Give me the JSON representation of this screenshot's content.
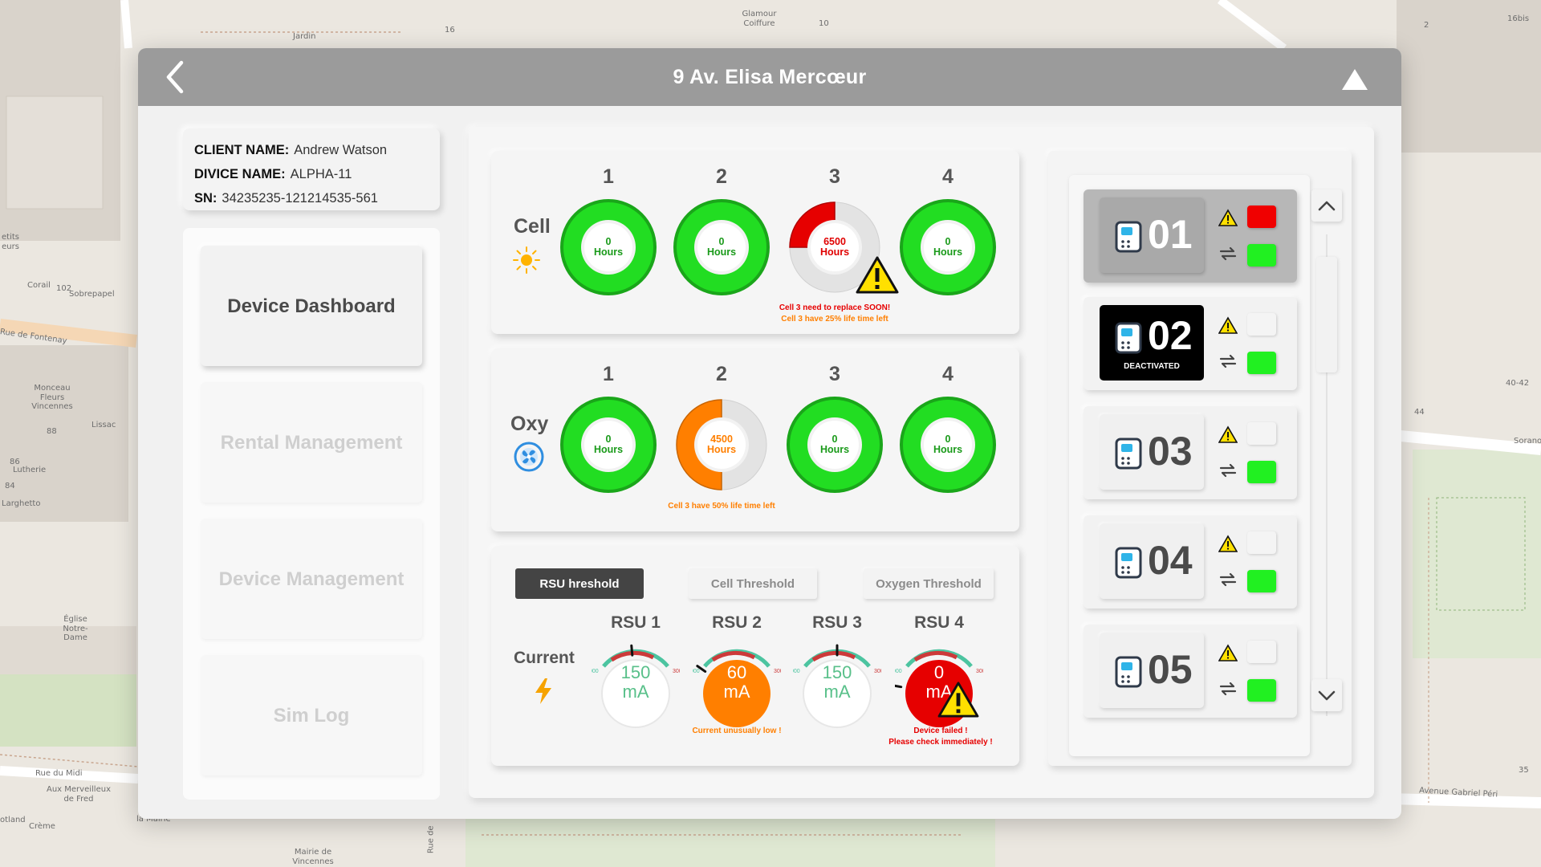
{
  "window": {
    "title": "9 Av. Elisa Mercœur"
  },
  "client": {
    "client_label": "CLIENT NAME:",
    "client_value": "Andrew Watson",
    "device_label": "DIVICE NAME:",
    "device_value": "ALPHA-11",
    "sn_label": "SN:",
    "sn_value": "34235235-121214535-561"
  },
  "nav": [
    {
      "label": "Device Dashboard",
      "active": true
    },
    {
      "label": "Rental Management",
      "active": false
    },
    {
      "label": "Device Management",
      "active": false
    },
    {
      "label": "Sim Log",
      "active": false
    }
  ],
  "cell_section": {
    "label": "Cell",
    "icon": "sun-icon",
    "units": [
      {
        "num": "1",
        "value": "0",
        "unit": "Hours",
        "fill": 1.0,
        "status": "ok"
      },
      {
        "num": "2",
        "value": "0",
        "unit": "Hours",
        "fill": 1.0,
        "status": "ok"
      },
      {
        "num": "3",
        "value": "6500",
        "unit": "Hours",
        "fill": 0.25,
        "status": "critical"
      },
      {
        "num": "4",
        "value": "0",
        "unit": "Hours",
        "fill": 1.0,
        "status": "ok"
      }
    ],
    "warning_line1": "Cell 3 need to replace SOON!",
    "warning_line2": "Cell 3 have 25% life time left"
  },
  "oxy_section": {
    "label": "Oxy",
    "icon": "fan-icon",
    "units": [
      {
        "num": "1",
        "value": "0",
        "unit": "Hours",
        "fill": 1.0,
        "status": "ok"
      },
      {
        "num": "2",
        "value": "4500",
        "unit": "Hours",
        "fill": 0.5,
        "status": "warning"
      },
      {
        "num": "3",
        "value": "0",
        "unit": "Hours",
        "fill": 1.0,
        "status": "ok"
      },
      {
        "num": "4",
        "value": "0",
        "unit": "Hours",
        "fill": 1.0,
        "status": "ok"
      }
    ],
    "warning_line1": "Cell 3 have 50% life time left"
  },
  "threshold_section": {
    "tabs": [
      "RSU hreshold",
      "Cell Threshold",
      "Oxygen Threshold"
    ],
    "active_tab": 0,
    "row_label": "Current",
    "icon": "lightning-icon",
    "scale_min": "000",
    "scale_max": "300",
    "rsus": [
      {
        "name": "RSU 1",
        "value": "150",
        "unit": "mA",
        "status": "ok"
      },
      {
        "name": "RSU 2",
        "value": "60",
        "unit": "mA",
        "status": "warning"
      },
      {
        "name": "RSU 3",
        "value": "150",
        "unit": "mA",
        "status": "ok"
      },
      {
        "name": "RSU 4",
        "value": "0",
        "unit": "mA",
        "status": "critical"
      }
    ],
    "rsu2_message": "Current unusually low !",
    "rsu4_message_line1": "Device failed !",
    "rsu4_message_line2": "Please check immediately !"
  },
  "devices": [
    {
      "num": "01",
      "sub": "",
      "style": "selected",
      "status_top": "red",
      "status_bottom": "green"
    },
    {
      "num": "02",
      "sub": "DEACTIVATED",
      "style": "dark",
      "status_top": "off",
      "status_bottom": "green"
    },
    {
      "num": "03",
      "sub": "",
      "style": "normal",
      "status_top": "off",
      "status_bottom": "green"
    },
    {
      "num": "04",
      "sub": "",
      "style": "normal",
      "status_top": "off",
      "status_bottom": "green"
    },
    {
      "num": "05",
      "sub": "",
      "style": "normal",
      "status_top": "off",
      "status_bottom": "green"
    }
  ],
  "colors": {
    "ok": "#22dd22",
    "ok_dark": "#1aa61a",
    "warning": "#ff7f00",
    "critical": "#e60000",
    "warning_text": "#ff7f00",
    "critical_text": "#e60000"
  },
  "map_labels": {
    "jardin": "Jardin",
    "glamour": "Glamour Coiffure",
    "corail": "Corail",
    "sobrepapel": "Sobrepapel",
    "petits": "etits eurs",
    "fontenay": "Rue de Fontenay",
    "monceau": "Monceau Fleurs Vincennes",
    "lissac": "Lissac",
    "lutherie": "Lutherie",
    "larghetto": "Larghetto",
    "eglise": "Église Notre-Dame",
    "midi": "Rue du Midi",
    "merveilleux": "Aux Merveilleux de Fred",
    "creme": "Crème",
    "otland": "otland",
    "mairie": "Mairie de Vincennes",
    "la_mairie": "la Mairie",
    "rue_de": "Rue de",
    "sorano": "Sorano",
    "gabriel": "Avenue Gabriel Péri",
    "n16bis": "16bis",
    "n10": "10",
    "n16": "16",
    "n2": "2",
    "n102": "102",
    "n88": "88",
    "n86": "86",
    "n84": "84",
    "n4042": "40-42",
    "n44": "44",
    "n35": "35"
  }
}
